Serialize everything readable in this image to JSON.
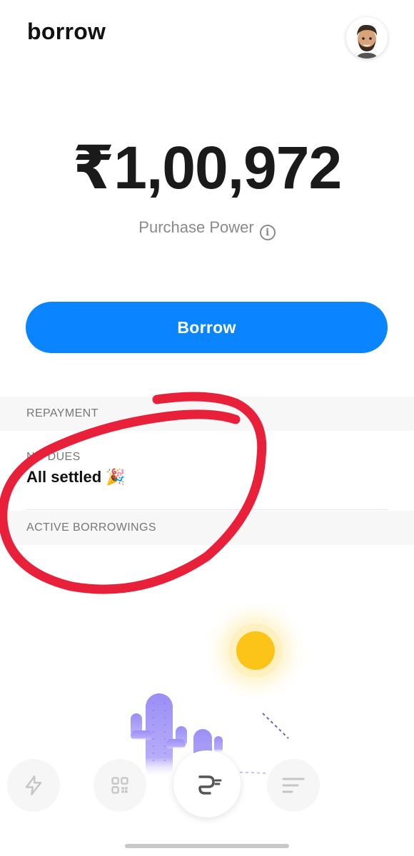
{
  "header": {
    "title": "borrow"
  },
  "balance": {
    "amount": "₹1,00,972",
    "label": "Purchase Power"
  },
  "actions": {
    "borrow_label": "Borrow"
  },
  "repayment": {
    "section_title": "REPAYMENT",
    "dues_label": "NO DUES",
    "dues_value": "All settled 🎉"
  },
  "active_borrowings": {
    "section_title": "ACTIVE BORROWINGS"
  },
  "nav": {
    "items": [
      "lightning-icon",
      "qr-grid-icon",
      "app-logo-icon",
      "menu-lines-icon"
    ]
  },
  "colors": {
    "accent": "#0a84ff",
    "annotation": "#e8203a",
    "sun": "#fcc419",
    "cactus": "#9b8ef5"
  }
}
